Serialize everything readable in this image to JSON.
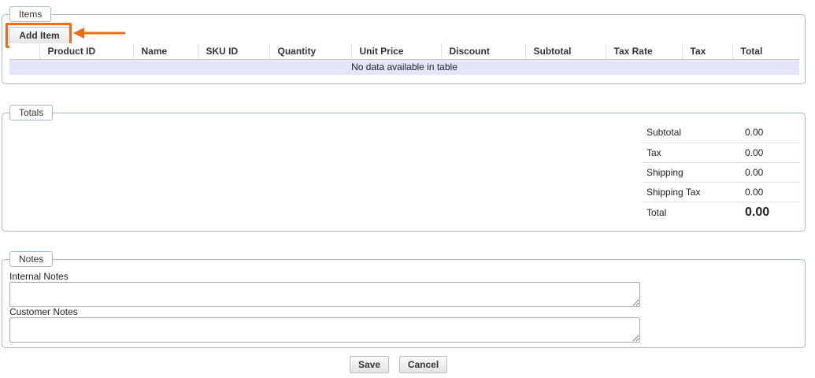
{
  "items": {
    "legend": "Items",
    "add_button": "Add Item",
    "columns": [
      "",
      "Product ID",
      "Name",
      "SKU ID",
      "Quantity",
      "Unit Price",
      "Discount",
      "Subtotal",
      "Tax Rate",
      "Tax",
      "Total"
    ],
    "empty_message": "No data available in table"
  },
  "totals": {
    "legend": "Totals",
    "rows": [
      {
        "label": "Subtotal",
        "value": "0.00"
      },
      {
        "label": "Tax",
        "value": "0.00"
      },
      {
        "label": "Shipping",
        "value": "0.00"
      },
      {
        "label": "Shipping Tax",
        "value": "0.00"
      },
      {
        "label": "Total",
        "value": "0.00"
      }
    ]
  },
  "notes": {
    "legend": "Notes",
    "internal_label": "Internal Notes",
    "internal_value": "",
    "customer_label": "Customer Notes",
    "customer_value": ""
  },
  "actions": {
    "save": "Save",
    "cancel": "Cancel"
  },
  "colors": {
    "highlight": "#f26b12",
    "empty_row_bg": "#e4e4fb",
    "fieldset_border": "#a9b8c9"
  }
}
